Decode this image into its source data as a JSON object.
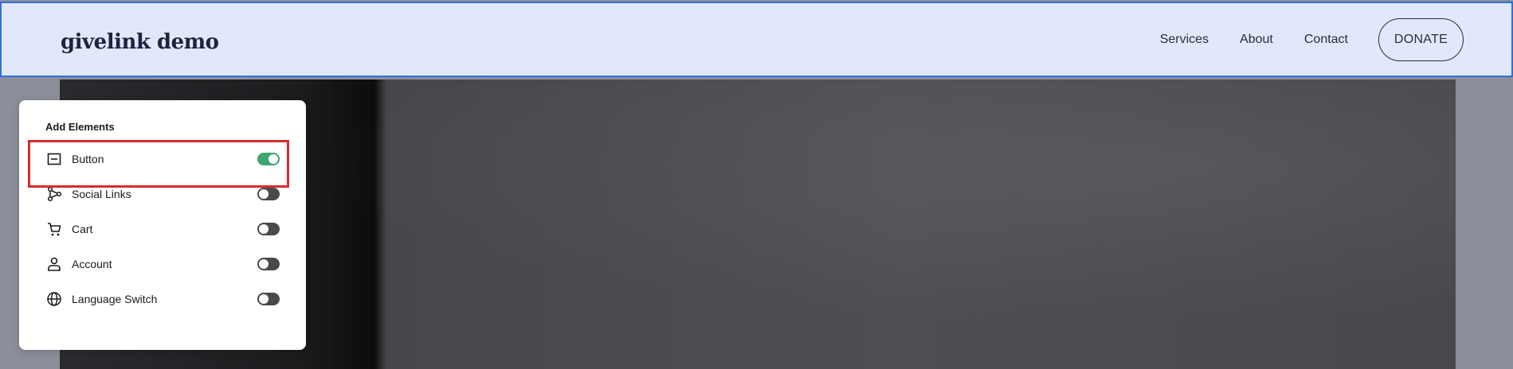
{
  "header": {
    "logo": "givelink demo",
    "nav": [
      "Services",
      "About",
      "Contact"
    ],
    "donate_label": "DONATE"
  },
  "panel": {
    "title": "Add Elements",
    "items": [
      {
        "label": "Button",
        "icon": "button-icon",
        "enabled": true
      },
      {
        "label": "Social Links",
        "icon": "share-icon",
        "enabled": false
      },
      {
        "label": "Cart",
        "icon": "cart-icon",
        "enabled": false
      },
      {
        "label": "Account",
        "icon": "person-icon",
        "enabled": false
      },
      {
        "label": "Language Switch",
        "icon": "globe-icon",
        "enabled": false
      }
    ]
  },
  "colors": {
    "header_bg": "#e2e8fb",
    "header_border": "#2f6fe4",
    "toggle_on": "#3fa66f",
    "toggle_off": "#4a4a4a",
    "highlight": "#d92b2b"
  }
}
